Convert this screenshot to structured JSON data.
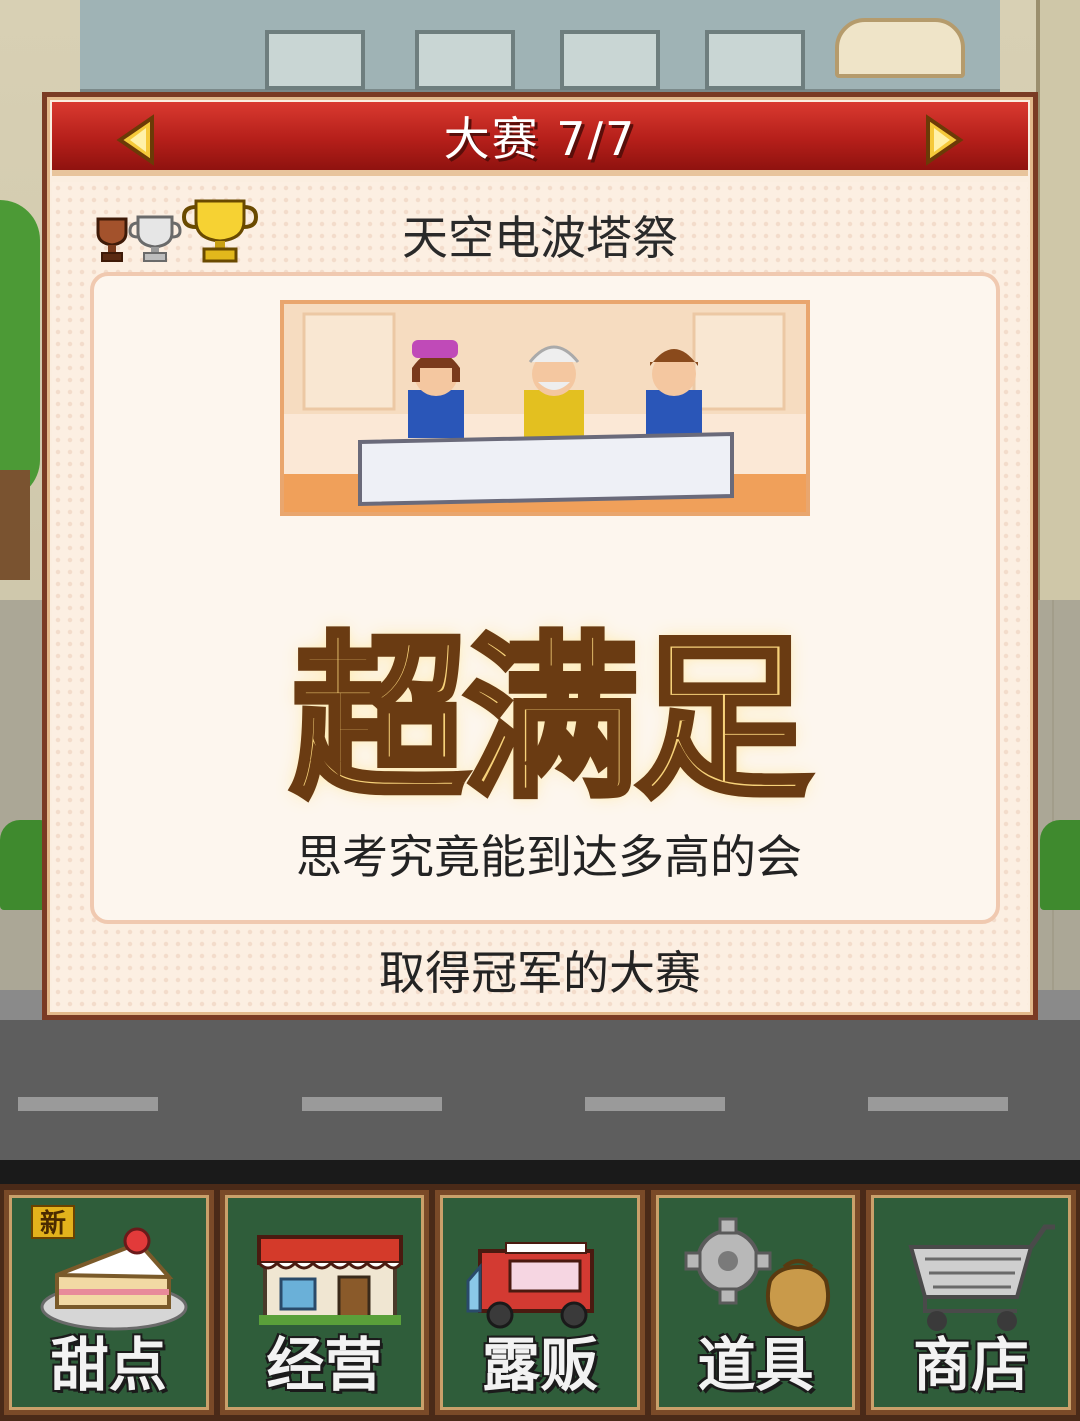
{
  "header": {
    "title": "大赛 7/7",
    "prev_icon": "arrow-left-icon",
    "next_icon": "arrow-right-icon"
  },
  "contest": {
    "name": "天空电波塔祭",
    "rating": "超满足",
    "description": "思考究竟能到达多高的会",
    "footer": "取得冠军的大赛",
    "trophies": [
      "bronze-trophy-icon",
      "silver-trophy-icon",
      "gold-trophy-icon"
    ]
  },
  "menu": {
    "items": [
      {
        "label": "甜点",
        "icon": "cake-icon",
        "badge": "新"
      },
      {
        "label": "经营",
        "icon": "shop-icon"
      },
      {
        "label": "露贩",
        "icon": "food-truck-icon"
      },
      {
        "label": "道具",
        "icon": "gear-bag-icon"
      },
      {
        "label": "商店",
        "icon": "shopping-cart-icon"
      }
    ]
  },
  "colors": {
    "header_red": "#b51f1a",
    "panel_bg": "#fcefe2",
    "rating_gold": "#f7d27a",
    "menu_green": "#2f5d3a"
  }
}
